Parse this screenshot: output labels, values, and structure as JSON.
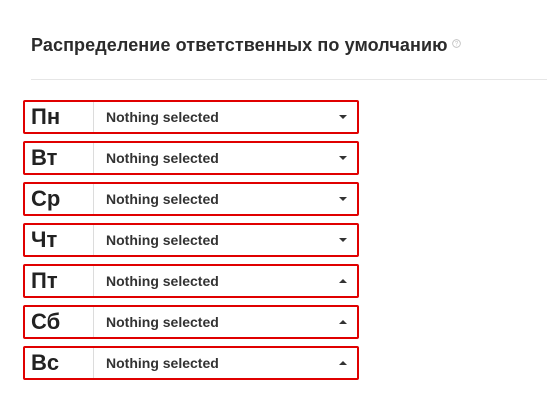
{
  "section": {
    "title": "Распределение ответственных по умолчанию",
    "help_icon": "question-circle-icon"
  },
  "days": [
    {
      "label": "Пн",
      "value": "Nothing selected",
      "caret": "down"
    },
    {
      "label": "Вт",
      "value": "Nothing selected",
      "caret": "down"
    },
    {
      "label": "Ср",
      "value": "Nothing selected",
      "caret": "down"
    },
    {
      "label": "Чт",
      "value": "Nothing selected",
      "caret": "down"
    },
    {
      "label": "Пт",
      "value": "Nothing selected",
      "caret": "up"
    },
    {
      "label": "Сб",
      "value": "Nothing selected",
      "caret": "up"
    },
    {
      "label": "Вс",
      "value": "Nothing selected",
      "caret": "up"
    }
  ],
  "colors": {
    "highlight_border": "#e00000",
    "divider": "#e6e6e6"
  }
}
